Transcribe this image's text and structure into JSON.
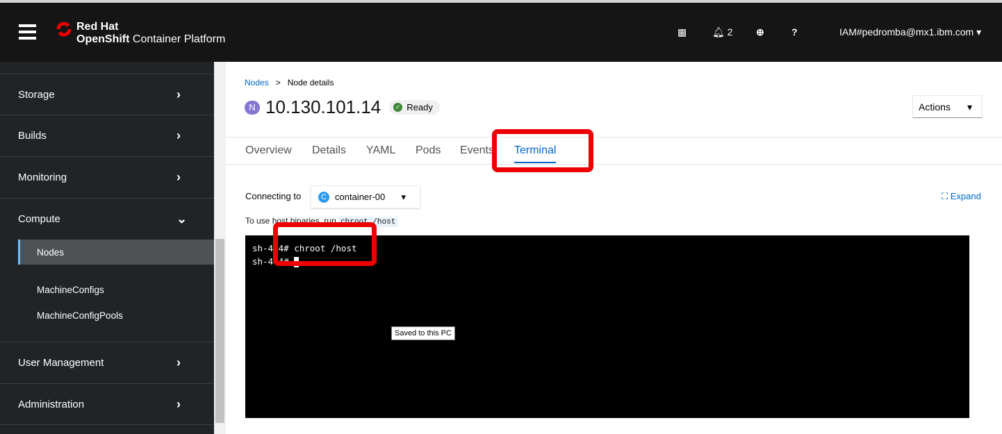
{
  "masthead": {
    "brand_line1": "Red Hat",
    "brand_line2_bold": "OpenShift",
    "brand_line2": " Container Platform",
    "notifications": "2",
    "user": "IAM#pedromba@mx1.ibm.com",
    "icons": [
      "grid-icon",
      "bell-icon",
      "plus-circle-icon",
      "help-icon"
    ]
  },
  "sidebar": {
    "items": [
      {
        "label": "Storage"
      },
      {
        "label": "Builds"
      },
      {
        "label": "Monitoring"
      },
      {
        "label": "Compute",
        "expanded": true
      },
      {
        "label": "User Management"
      },
      {
        "label": "Administration"
      }
    ],
    "compute_sub": [
      {
        "label": "Nodes",
        "active": true
      },
      {
        "label": "MachineConfigs"
      },
      {
        "label": "MachineConfigPools"
      }
    ]
  },
  "breadcrumb": {
    "parent": "Nodes",
    "sep": ">",
    "current": "Node details"
  },
  "node": {
    "badge": "N",
    "name": "10.130.101.14",
    "status": "Ready",
    "status_color": "#3e8635"
  },
  "actions_label": "Actions",
  "tabs": [
    {
      "label": "Overview"
    },
    {
      "label": "Details"
    },
    {
      "label": "YAML"
    },
    {
      "label": "Pods"
    },
    {
      "label": "Events"
    },
    {
      "label": "Terminal",
      "active": true
    }
  ],
  "terminal": {
    "connecting_label": "Connecting to",
    "container_badge": "C",
    "container": "container-00",
    "expand": "Expand",
    "hint": "To use host binaries, run ",
    "hint_code": "chroot /host",
    "lines": [
      "sh-4.4# chroot /host",
      "sh-4.4# "
    ]
  },
  "tooltip": "Saved to this PC",
  "highlight_color": "#e00000"
}
